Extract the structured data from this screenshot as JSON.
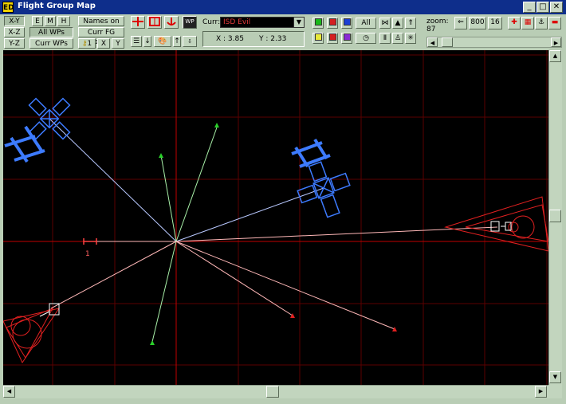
{
  "window": {
    "title": "Flight Group Map",
    "app_icon": "ED",
    "controls": [
      "minimize",
      "maximize",
      "close"
    ]
  },
  "views": {
    "xy": "X-Y",
    "xz": "X-Z",
    "yz": "Y-Z"
  },
  "modes": {
    "e": "E",
    "m": "M",
    "h": "H"
  },
  "waypoint_filters": {
    "all_wps": "All WPs",
    "curr_wps": "Curr WPs"
  },
  "labels": {
    "names_on": "Names on",
    "curr_fg_only": "Curr FG only",
    "wp_button": "WP",
    "x_btn": "X",
    "y_btn": "Y",
    "wp_key": "1"
  },
  "current_fg": {
    "label": "Curr:",
    "value": "ISD Evil"
  },
  "coords": {
    "x": "X : 3.85",
    "y": "Y : 2.33"
  },
  "iff": {
    "all_label": "All",
    "colors": [
      "#19b819",
      "#d42020",
      "#1a3fd4",
      "#e8e83a",
      "#d42020",
      "#8a2ad4"
    ]
  },
  "zoom": {
    "label": "zoom:",
    "value": "87"
  },
  "size_buttons": {
    "b800": "800",
    "b16": "16"
  },
  "waypoint_marker_label": "1",
  "icons": [
    "cross-icon",
    "shuttle-icon",
    "anchor-icon",
    "arrow-up-icon",
    "palette-icon",
    "clock-icon",
    "triangle-icon",
    "person-icon",
    "bullseye-icon",
    "grid-icon"
  ]
}
